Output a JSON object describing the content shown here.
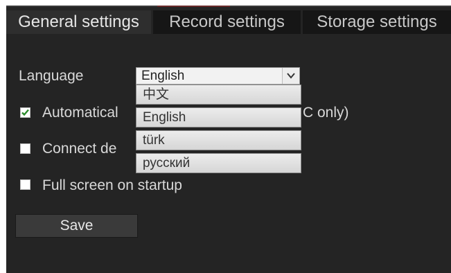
{
  "tabs": [
    {
      "label": "General settings",
      "active": true
    },
    {
      "label": "Record settings",
      "active": false
    },
    {
      "label": "Storage settings",
      "active": false
    }
  ],
  "language": {
    "label": "Language",
    "selected": "English",
    "options": [
      "中文",
      "English",
      "türk",
      "русский"
    ]
  },
  "options": {
    "auto_label_start": "Automatical",
    "auto_label_end": "C only)",
    "auto_checked": true,
    "connect_label": "Connect de",
    "connect_checked": false,
    "fullscreen_label": "Full screen on startup",
    "fullscreen_checked": false
  },
  "save_label": "Save",
  "colors": {
    "panel_bg": "#242424",
    "text": "#d9d9d9",
    "check": "#2a8a2a"
  }
}
